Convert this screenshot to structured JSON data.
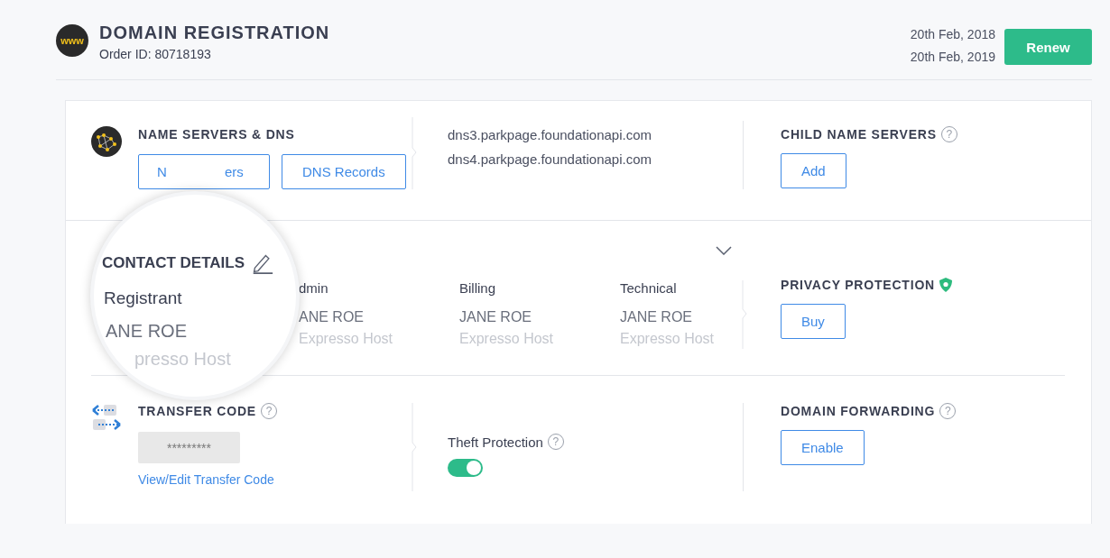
{
  "header": {
    "logo_text": "www",
    "title": "DOMAIN REGISTRATION",
    "order_id": "Order ID: 80718193",
    "dates": [
      "20th Feb, 2018",
      "20th Feb, 2019"
    ],
    "renew_button": "Renew"
  },
  "name_servers": {
    "title": "NAME SERVERS & DNS",
    "name_servers_button": [
      "N",
      "ers"
    ],
    "dns_button": "DNS Records",
    "servers": [
      "dns3.parkpage.foundationapi.com",
      "dns4.parkpage.foundationapi.com"
    ]
  },
  "child_name_servers": {
    "title": "CHILD NAME SERVERS",
    "help": "?",
    "button": "Add"
  },
  "contact_details": {
    "columns": [
      {
        "role": "dmin",
        "name": "ANE ROE",
        "company": "Expresso Host"
      },
      {
        "role": "Billing",
        "name": "JANE ROE",
        "company": "Expresso Host"
      },
      {
        "role": "Technical",
        "name": "JANE ROE",
        "company": "Expresso Host"
      }
    ]
  },
  "magnifier": {
    "title": "CONTACT DETAILS",
    "role": "Registrant",
    "name": "ANE ROE",
    "company": "presso Host"
  },
  "privacy_protection": {
    "title": "PRIVACY PROTECTION",
    "button": "Buy"
  },
  "transfer_code": {
    "title": "TRANSFER CODE",
    "help": "?",
    "masked_code": "*********",
    "link": "View/Edit Transfer Code"
  },
  "theft_protection": {
    "label": "Theft Protection",
    "help": "?",
    "on": true
  },
  "domain_forwarding": {
    "title": "DOMAIN FORWARDING",
    "help": "?",
    "button": "Enable"
  }
}
